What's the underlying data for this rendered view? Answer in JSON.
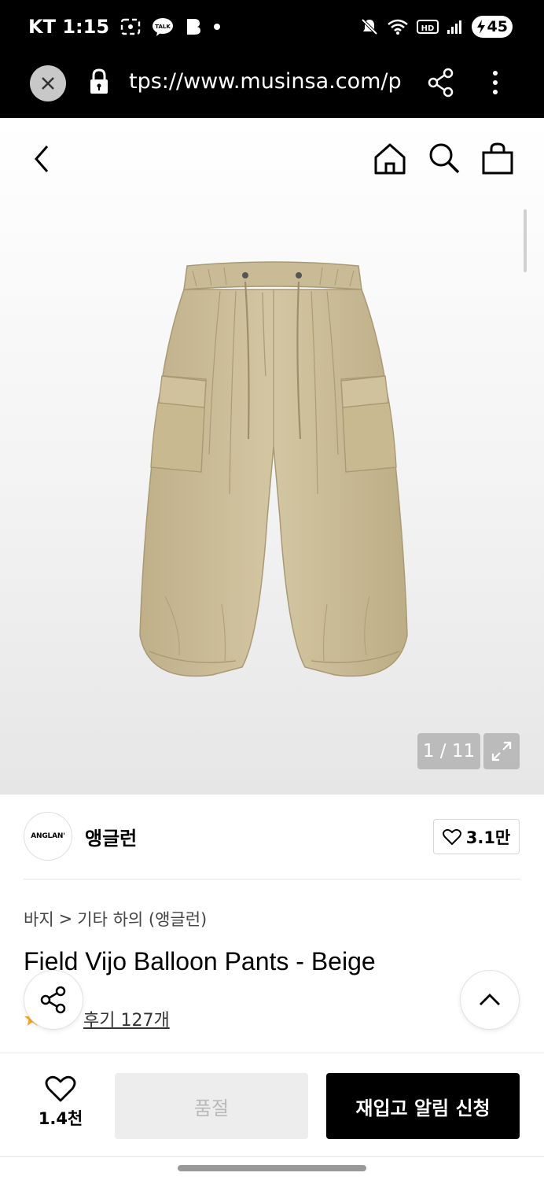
{
  "status_bar": {
    "carrier_time": "KT 1:15",
    "battery": "45"
  },
  "browser": {
    "url": "tps://www.musinsa.com/p"
  },
  "gallery": {
    "counter": "1 / 11"
  },
  "brand": {
    "logo_text": "ANGLAN'",
    "name": "앵글런",
    "likes": "3.1만"
  },
  "product": {
    "breadcrumb": [
      "바지",
      "기타 하의 (앵글런)"
    ],
    "breadcrumb_sep": ">",
    "title": "Field Vijo Balloon Pants - Beige",
    "review_link": "후기 127개"
  },
  "bottom": {
    "wish_count": "1.4천",
    "soldout_label": "품절",
    "restock_label": "재입고 알림 신청"
  },
  "colors": {
    "accent": "#000000",
    "pants": "#cbbd97",
    "star": "#f5a623"
  },
  "icons": [
    "close-icon",
    "lock-icon",
    "share-icon",
    "kebab-icon",
    "back-icon",
    "home-icon",
    "search-icon",
    "bag-icon",
    "expand-icon",
    "heart-icon",
    "chevron-up-icon",
    "star-icon"
  ]
}
